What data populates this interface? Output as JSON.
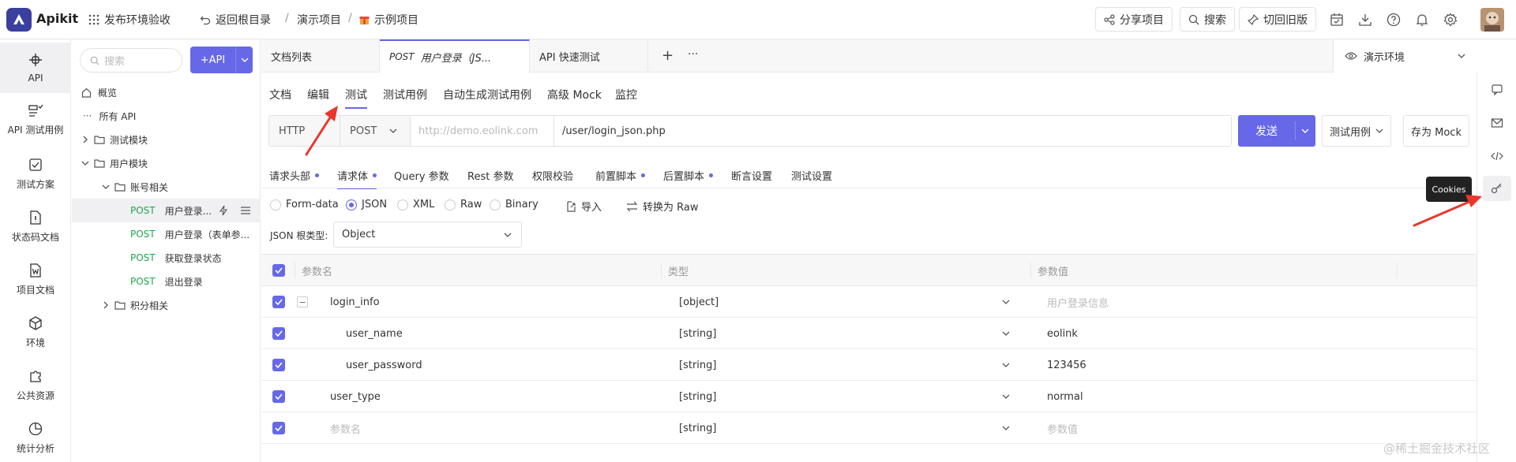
{
  "app": {
    "name": "Apikit"
  },
  "topbar": {
    "workspace": "发布环境验收",
    "back": "返回根目录",
    "project": "演示项目",
    "sub_project": "示例项目",
    "share": "分享项目",
    "search": "搜索",
    "switch_old": "切回旧版"
  },
  "leftnav": [
    {
      "label": "API",
      "icon": "api-icon"
    },
    {
      "label": "API 测试用例",
      "icon": "testcase-icon"
    },
    {
      "label": "测试方案",
      "icon": "plan-icon"
    },
    {
      "label": "状态码文档",
      "icon": "statuscode-doc-icon"
    },
    {
      "label": "项目文档",
      "icon": "word-doc-icon"
    },
    {
      "label": "环境",
      "icon": "environment-icon"
    },
    {
      "label": "公共资源",
      "icon": "puzzle-icon"
    },
    {
      "label": "统计分析",
      "icon": "pie-chart-icon"
    }
  ],
  "tree": {
    "search_placeholder": "搜索",
    "add_api": "+API",
    "items": [
      {
        "label": "概览"
      },
      {
        "label": "所有 API"
      },
      {
        "label": "测试模块"
      },
      {
        "label": "用户模块"
      },
      {
        "label": "账号相关"
      },
      {
        "method": "POST",
        "label": "用户登录..."
      },
      {
        "method": "POST",
        "label": "用户登录（表单参..."
      },
      {
        "method": "POST",
        "label": "获取登录状态"
      },
      {
        "method": "POST",
        "label": "退出登录"
      },
      {
        "label": "积分相关"
      }
    ]
  },
  "tabs": [
    {
      "label": "文档列表"
    },
    {
      "method": "POST",
      "label": "用户登录（JS..."
    },
    {
      "label": "API 快速测试"
    }
  ],
  "env": "演示环境",
  "subtabs": [
    "文档",
    "编辑",
    "测试",
    "测试用例",
    "自动生成测试用例",
    "高级 Mock",
    "监控"
  ],
  "request": {
    "protocol": "HTTP",
    "method": "POST",
    "host_placeholder": "http://demo.eolink.com",
    "path": "/user/login_json.php",
    "send": "发送",
    "test_case": "测试用例",
    "save_mock": "存为 Mock"
  },
  "reqtabs": [
    {
      "label": "请求头部",
      "dot": true
    },
    {
      "label": "请求体",
      "dot": true
    },
    {
      "label": "Query 参数",
      "dot": false
    },
    {
      "label": "Rest 参数",
      "dot": false
    },
    {
      "label": "权限校验",
      "dot": false
    },
    {
      "label": "前置脚本",
      "dot": true
    },
    {
      "label": "后置脚本",
      "dot": true
    },
    {
      "label": "断言设置",
      "dot": false
    },
    {
      "label": "测试设置",
      "dot": false
    }
  ],
  "body_types": [
    "Form-data",
    "JSON",
    "XML",
    "Raw",
    "Binary"
  ],
  "body_selected": "JSON",
  "import": "导入",
  "to_raw": "转换为 Raw",
  "json_root_label": "JSON 根类型:",
  "json_root_value": "Object",
  "table": {
    "headers": [
      "参数名",
      "类型",
      "参数值"
    ],
    "rows": [
      {
        "name": "login_info",
        "type": "[object]",
        "value": "用户登录信息",
        "value_placeholder": true
      },
      {
        "name": "user_name",
        "type": "[string]",
        "value": "eolink",
        "value_placeholder": false
      },
      {
        "name": "user_password",
        "type": "[string]",
        "value": "123456",
        "value_placeholder": false
      },
      {
        "name": "user_type",
        "type": "[string]",
        "value": "normal",
        "value_placeholder": false
      },
      {
        "name": "参数名",
        "type": "[string]",
        "value": "参数值",
        "value_placeholder": true
      }
    ]
  },
  "tooltip": "Cookies",
  "watermark": "@稀土掘金技术社区",
  "colors": {
    "accent": "#6668e8",
    "post": "#1da74c",
    "annotation": "#e8372c"
  }
}
